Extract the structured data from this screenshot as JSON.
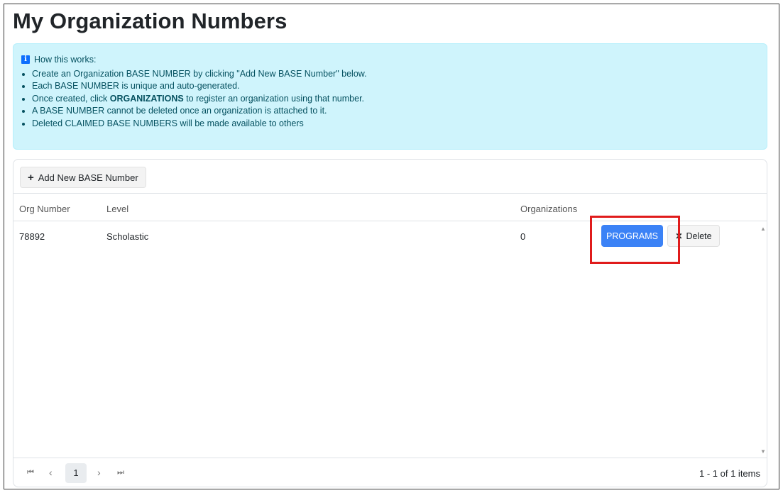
{
  "page": {
    "title": "My Organization Numbers"
  },
  "info": {
    "heading": "How this works:",
    "items": [
      {
        "before": "Create an Organization BASE NUMBER by clicking \"Add New BASE Number\" below.",
        "bold": "",
        "after": ""
      },
      {
        "before": "Each BASE NUMBER is unique and auto-generated.",
        "bold": "",
        "after": ""
      },
      {
        "before": "Once created, click ",
        "bold": "ORGANIZATIONS",
        "after": " to register an organization using that number."
      },
      {
        "before": "A BASE NUMBER cannot be deleted once an organization is attached to it.",
        "bold": "",
        "after": ""
      },
      {
        "before": "Deleted CLAIMED BASE NUMBERS will be made available to others",
        "bold": "",
        "after": ""
      }
    ]
  },
  "toolbar": {
    "add_label": "Add New BASE Number"
  },
  "grid": {
    "columns": {
      "org_number": "Org Number",
      "level": "Level",
      "organizations": "Organizations"
    },
    "rows": [
      {
        "org_number": "78892",
        "level": "Scholastic",
        "organizations": "0",
        "programs_label": "PROGRAMS",
        "delete_label": "Delete"
      }
    ]
  },
  "pager": {
    "first": "⏮",
    "prev": "‹",
    "current": "1",
    "next": "›",
    "last": "⏭",
    "info": "1 - 1 of 1 items"
  },
  "colors": {
    "accent": "#3b82f6",
    "info_bg": "#cff4fc",
    "highlight": "#e01b1b"
  },
  "icons": {
    "info": "info-icon",
    "add": "plus-icon",
    "delete": "close-icon"
  }
}
